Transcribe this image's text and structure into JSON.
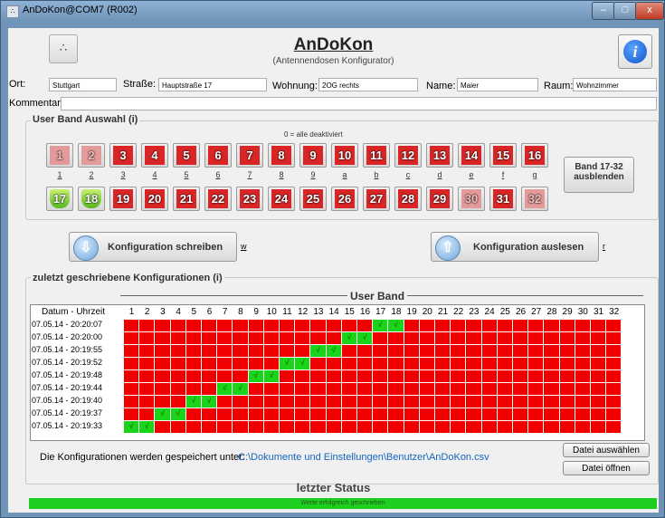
{
  "window": {
    "title": "AnDoKon@COM7 (R002)",
    "min": "–",
    "max": "□",
    "close": "x"
  },
  "header": {
    "title": "AnDoKon",
    "subtitle": "(Antennendosen Konfigurator)",
    "info": "i",
    "logo": "∴"
  },
  "form": {
    "ort_label": "Ort:",
    "ort": "Stuttgart",
    "strasse_label": "Straße:",
    "strasse": "Hauptstraße 17",
    "wohnung_label": "Wohnung:",
    "wohnung": "2OG rechts",
    "name_label": "Name:",
    "name": "Maier",
    "raum_label": "Raum:",
    "raum": "Wohnzimmer",
    "kommentar_label": "Kommentar:",
    "kommentar": ""
  },
  "bands": {
    "group_title": "User Band Auswahl (i)",
    "hint": "0 = alle deaktiviert",
    "row1": [
      {
        "n": "1",
        "key": "1",
        "state": "disabled"
      },
      {
        "n": "2",
        "key": "2",
        "state": "disabled"
      },
      {
        "n": "3",
        "key": "3",
        "state": "off"
      },
      {
        "n": "4",
        "key": "4",
        "state": "off"
      },
      {
        "n": "5",
        "key": "5",
        "state": "off"
      },
      {
        "n": "6",
        "key": "6",
        "state": "off"
      },
      {
        "n": "7",
        "key": "7",
        "state": "off"
      },
      {
        "n": "8",
        "key": "8",
        "state": "off"
      },
      {
        "n": "9",
        "key": "9",
        "state": "off"
      },
      {
        "n": "10",
        "key": "a",
        "state": "off"
      },
      {
        "n": "11",
        "key": "b",
        "state": "off"
      },
      {
        "n": "12",
        "key": "c",
        "state": "off"
      },
      {
        "n": "13",
        "key": "d",
        "state": "off"
      },
      {
        "n": "14",
        "key": "e",
        "state": "off"
      },
      {
        "n": "15",
        "key": "f",
        "state": "off"
      },
      {
        "n": "16",
        "key": "g",
        "state": "off"
      }
    ],
    "row2": [
      {
        "n": "17",
        "state": "on"
      },
      {
        "n": "18",
        "state": "on"
      },
      {
        "n": "19",
        "state": "off"
      },
      {
        "n": "20",
        "state": "off"
      },
      {
        "n": "21",
        "state": "off"
      },
      {
        "n": "22",
        "state": "off"
      },
      {
        "n": "23",
        "state": "off"
      },
      {
        "n": "24",
        "state": "off"
      },
      {
        "n": "25",
        "state": "off"
      },
      {
        "n": "26",
        "state": "off"
      },
      {
        "n": "27",
        "state": "off"
      },
      {
        "n": "28",
        "state": "off"
      },
      {
        "n": "29",
        "state": "off"
      },
      {
        "n": "30",
        "state": "disabled"
      },
      {
        "n": "31",
        "state": "off"
      },
      {
        "n": "32",
        "state": "disabled"
      }
    ],
    "toggle_label": "Band 17-32 ausblenden"
  },
  "actions": {
    "write_label": "Konfiguration schreiben",
    "write_key": "w",
    "read_label": "Konfiguration auslesen",
    "read_key": "r"
  },
  "history": {
    "group_title": "zuletzt geschriebene Konfigurationen (i)",
    "band_header": "User Band",
    "datum_header": "Datum - Uhrzeit",
    "columns": [
      "1",
      "2",
      "3",
      "4",
      "5",
      "6",
      "7",
      "8",
      "9",
      "10",
      "11",
      "12",
      "13",
      "14",
      "15",
      "16",
      "17",
      "18",
      "19",
      "20",
      "21",
      "22",
      "23",
      "24",
      "25",
      "26",
      "27",
      "28",
      "29",
      "30",
      "31",
      "32"
    ],
    "check": "√",
    "rows": [
      {
        "datum": "07.05.14 - 20:20:07",
        "on": [
          17,
          18
        ]
      },
      {
        "datum": "07.05.14 - 20:20:00",
        "on": [
          15,
          16
        ]
      },
      {
        "datum": "07.05.14 - 20:19:55",
        "on": [
          13,
          14
        ]
      },
      {
        "datum": "07.05.14 - 20:19:52",
        "on": [
          11,
          12
        ]
      },
      {
        "datum": "07.05.14 - 20:19:48",
        "on": [
          9,
          10
        ]
      },
      {
        "datum": "07.05.14 - 20:19:44",
        "on": [
          7,
          8
        ]
      },
      {
        "datum": "07.05.14 - 20:19:40",
        "on": [
          5,
          6
        ]
      },
      {
        "datum": "07.05.14 - 20:19:37",
        "on": [
          3,
          4
        ]
      },
      {
        "datum": "07.05.14 - 20:19:33",
        "on": [
          1,
          2
        ]
      }
    ],
    "saved_text": "Die Konfigurationen werden gespeichert unter:",
    "saved_path": "C:\\Dokumente und Einstellungen\\Benutzer\\AnDoKon.csv",
    "choose_label": "Datei auswählen",
    "open_label": "Datei öffnen"
  },
  "status": {
    "title": "letzter Status",
    "message": "Werte erfolgreich geschrieben"
  },
  "colors": {
    "off": "#f20000",
    "on": "#19d419",
    "status": "#1fcf1f"
  }
}
